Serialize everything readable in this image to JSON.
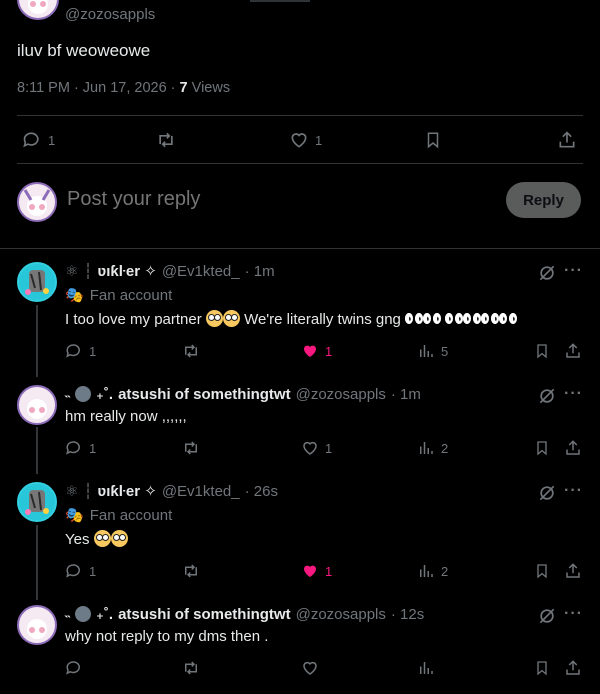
{
  "original_post": {
    "handle": "@zozosappls",
    "text": "iluv bf weoweowe",
    "time": "8:11 PM · Jun 17, 2026 · ",
    "views_count": "7",
    "views_label": " Views",
    "replies": "1",
    "likes": "1"
  },
  "composer": {
    "placeholder": "Post your reply",
    "button": "Reply"
  },
  "replies": [
    {
      "name": "ʋıƙŀer ✧",
      "handle": "@Ev1kted_",
      "time": "· 1m",
      "label": "Fan account",
      "text": "I too love my partner",
      "text2": "We're literally twins gng",
      "replies": "1",
      "likes": "1",
      "views": "5",
      "liked": true
    },
    {
      "name": "atsushi of somethingtwt",
      "handle": "@zozosappls",
      "time": "· 1m",
      "text": "hm really now ,,,,,,",
      "replies": "1",
      "likes": "1",
      "views": "2",
      "liked": false
    },
    {
      "name": "ʋıƙŀer ✧",
      "handle": "@Ev1kted_",
      "time": "· 26s",
      "label": "Fan account",
      "text": "Yes",
      "replies": "1",
      "likes": "1",
      "views": "2",
      "liked": true
    },
    {
      "name": "atsushi of somethingtwt",
      "handle": "@zozosappls",
      "time": "· 12s",
      "text": "why not reply to my dms then .",
      "replies": "",
      "likes": "",
      "views": "",
      "liked": false
    }
  ],
  "colors": {
    "like_active": "#f91880",
    "muted": "#71767b",
    "background": "#000000"
  }
}
